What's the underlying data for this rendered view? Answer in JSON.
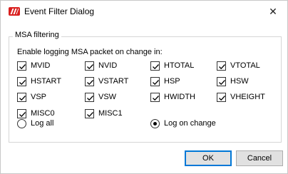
{
  "window": {
    "title": "Event Filter Dialog",
    "close_glyph": "✕",
    "app_icon": "app-logo-icon"
  },
  "group": {
    "legend": "MSA filtering",
    "prompt": "Enable logging MSA packet on change in:"
  },
  "checkboxes": [
    {
      "label": "MVID",
      "checked": true
    },
    {
      "label": "NVID",
      "checked": true
    },
    {
      "label": "HTOTAL",
      "checked": true
    },
    {
      "label": "VTOTAL",
      "checked": true
    },
    {
      "label": "HSTART",
      "checked": true
    },
    {
      "label": "VSTART",
      "checked": true
    },
    {
      "label": "HSP",
      "checked": true
    },
    {
      "label": "HSW",
      "checked": true
    },
    {
      "label": "VSP",
      "checked": true
    },
    {
      "label": "VSW",
      "checked": true
    },
    {
      "label": "HWIDTH",
      "checked": true
    },
    {
      "label": "VHEIGHT",
      "checked": true
    },
    {
      "label": "MISC0",
      "checked": true
    },
    {
      "label": "MISC1",
      "checked": true
    }
  ],
  "radios": [
    {
      "label": "Log all",
      "selected": false
    },
    {
      "label": "Log on change",
      "selected": true
    }
  ],
  "buttons": {
    "ok": "OK",
    "cancel": "Cancel"
  },
  "colors": {
    "accent": "#0078d7",
    "app_icon": "#d9201f"
  }
}
